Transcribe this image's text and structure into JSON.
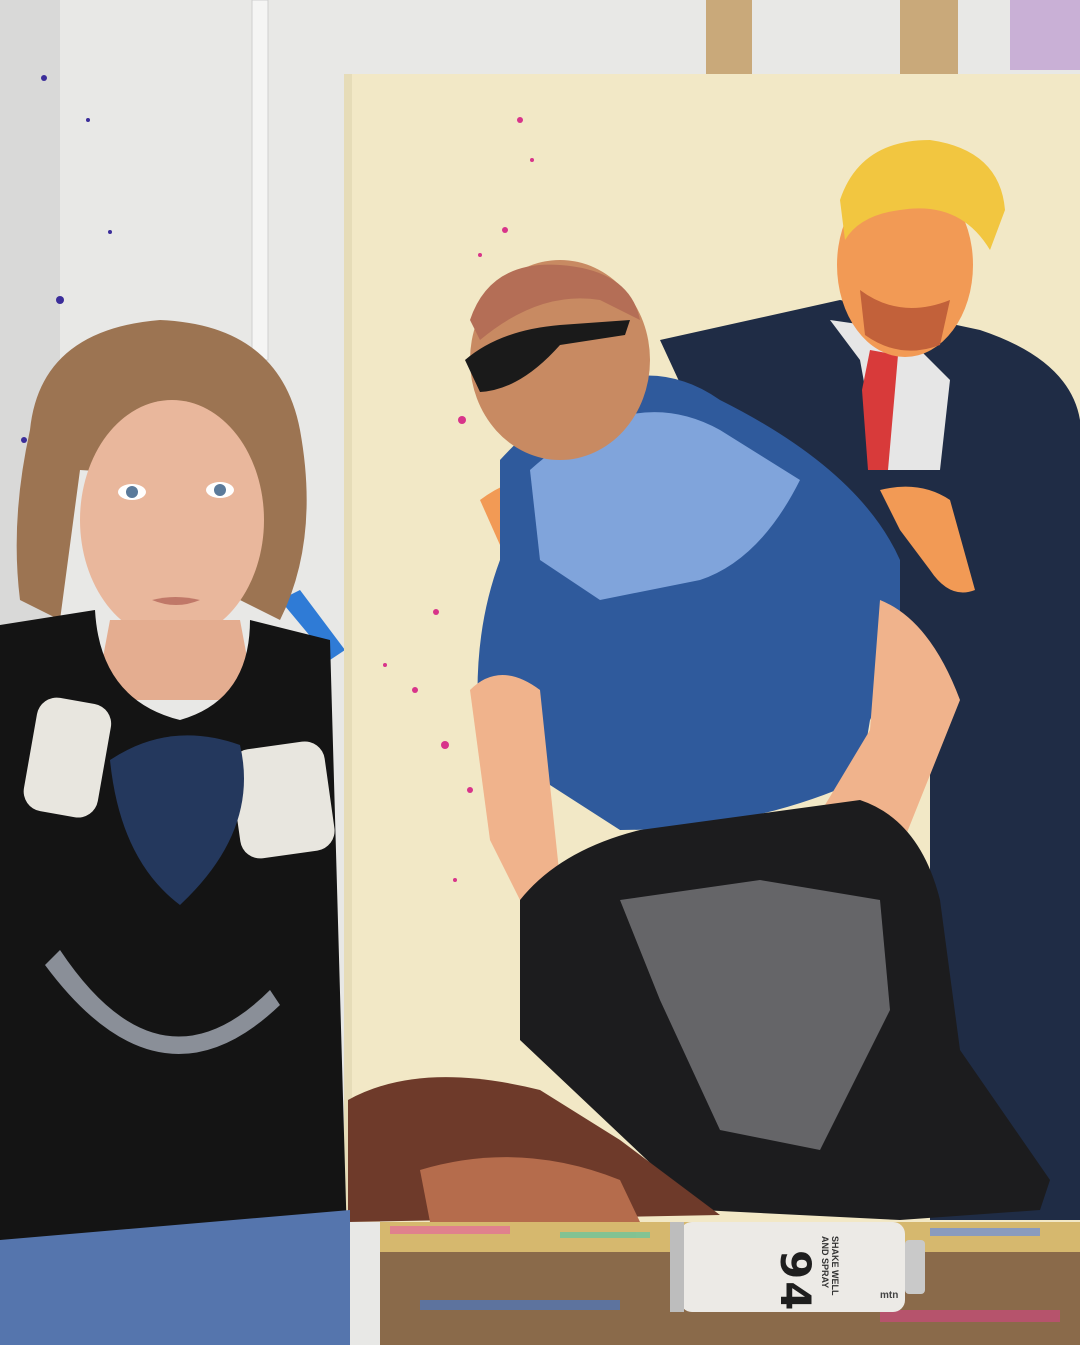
{
  "photo": {
    "colors": {
      "wall": "#e8e8e6",
      "canvas": "#f2e8c6",
      "easel_wood": "#c9a97a",
      "uniform_blue": "#2f5a9c",
      "uniform_light": "#8eb2e6",
      "suit_navy": "#1f2c45",
      "tie_red": "#d83a3a",
      "trump_hair": "#f2c640",
      "skin_orange": "#f29a55",
      "pants_black": "#1c1c1e",
      "paint_splatter": "#d8348a"
    },
    "spray_can": {
      "number": "94",
      "text": "SHAKE WELL AND SPRAY",
      "brand": "mtn"
    }
  }
}
